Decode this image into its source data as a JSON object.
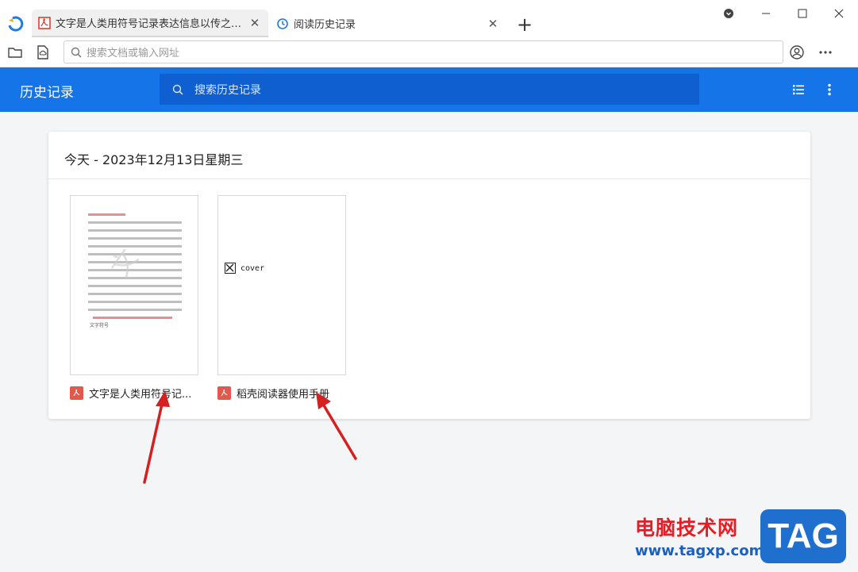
{
  "tabs": [
    {
      "label": "文字是人类用符号记录表达信息以传之久远...",
      "icon": "pdf-icon",
      "active": true
    },
    {
      "label": "阅读历史记录",
      "icon": "history-icon",
      "active": false
    }
  ],
  "new_tab_symbol": "+",
  "address_bar": {
    "placeholder": "搜索文档或输入网址"
  },
  "history_page": {
    "title": "历史记录",
    "search_placeholder": "搜索历史记录",
    "day_heading": "今天 - 2023年12月13日星期三",
    "documents": [
      {
        "name": "文字是人类用符号记...",
        "preview": "text-page",
        "preview_caption": "文字符号"
      },
      {
        "name": "稻壳阅读器使用手册",
        "preview": "broken-image",
        "preview_alt": "cover"
      }
    ]
  },
  "site_watermark": {
    "cn": "电脑技术网",
    "url": "www.tagxp.com",
    "badge": "TAG"
  },
  "colors": {
    "header_blue": "#1574e8",
    "search_blue": "#0f5fd1",
    "pdf_red": "#e0594d",
    "arrow_red": "#d42020"
  }
}
